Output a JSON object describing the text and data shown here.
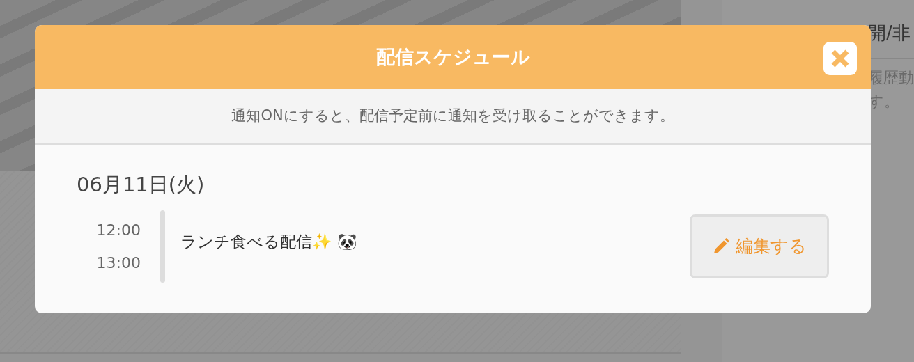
{
  "background": {
    "panel": {
      "heading": "開/非",
      "notice_lines": [
        "履歴動",
        "す。"
      ]
    }
  },
  "modal": {
    "title": "配信スケジュール",
    "notice": "通知ONにすると、配信予定前に通知を受け取ることができます。",
    "days": [
      {
        "date": "06月11日(火)",
        "events": [
          {
            "start": "12:00",
            "end": "13:00",
            "title": "ランチ食べる配信✨ 🐼",
            "edit_label": "編集する"
          }
        ]
      }
    ]
  }
}
